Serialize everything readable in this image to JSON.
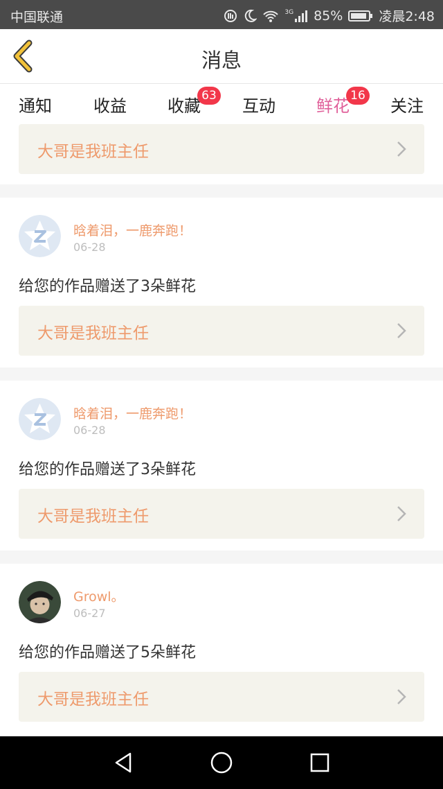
{
  "status_bar": {
    "carrier": "中国联通",
    "network": "3G",
    "battery": "85%",
    "time": "凌晨2:48"
  },
  "header": {
    "title": "消息",
    "back_icon": "chevron-left-icon"
  },
  "tabs": [
    {
      "label": "通知",
      "badge": ""
    },
    {
      "label": "收益",
      "badge": ""
    },
    {
      "label": "收藏",
      "badge": "63"
    },
    {
      "label": "互动",
      "badge": ""
    },
    {
      "label": "鲜花",
      "badge": "16",
      "active": true
    },
    {
      "label": "关注",
      "badge": ""
    }
  ],
  "messages": [
    {
      "user": "",
      "date": "",
      "text": "",
      "work_title": "大哥是我班主任"
    },
    {
      "user": "晗着泪，一鹿奔跑！",
      "date": "06-28",
      "text": "给您的作品赠送了3朵鲜花",
      "work_title": "大哥是我班主任",
      "avatar": "default-qzone-avatar"
    },
    {
      "user": "晗着泪，一鹿奔跑！",
      "date": "06-28",
      "text": "给您的作品赠送了3朵鲜花",
      "work_title": "大哥是我班主任",
      "avatar": "default-qzone-avatar"
    },
    {
      "user": "Growl。",
      "date": "06-27",
      "text": "给您的作品赠送了5朵鲜花",
      "work_title": "大哥是我班主任",
      "avatar": "photo-avatar"
    }
  ],
  "colors": {
    "accent_pink": "#e0609a",
    "badge_red": "#f2374a",
    "username_orange": "#ee9a6c",
    "link_box_bg": "#f4f3ec",
    "back_icon_yellow": "#f2c23a"
  },
  "navbar": [
    "back-triangle-icon",
    "home-circle-icon",
    "recent-square-icon"
  ]
}
